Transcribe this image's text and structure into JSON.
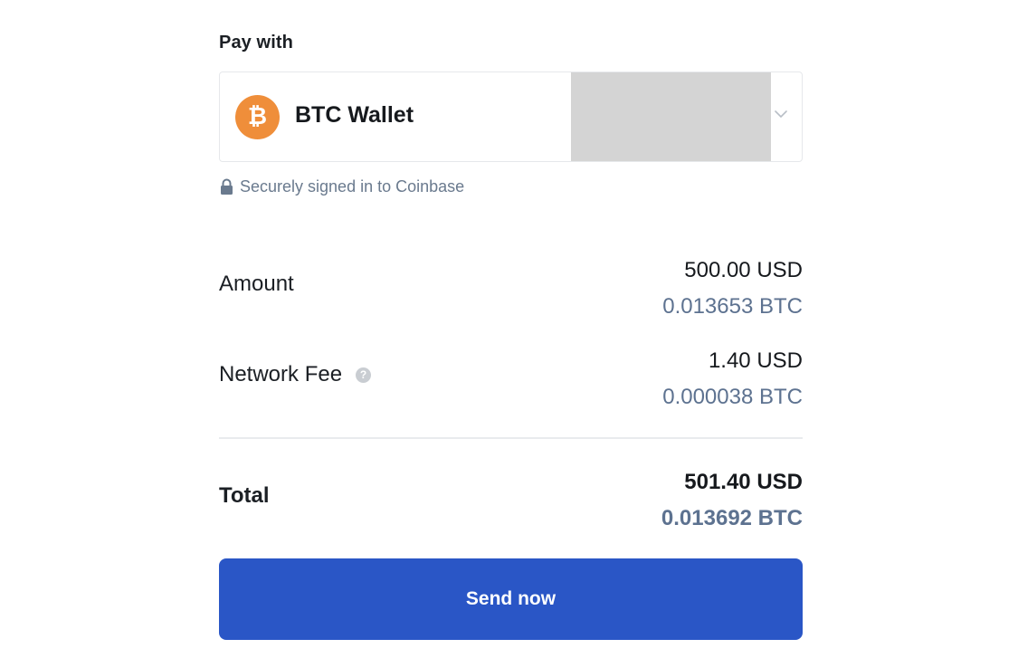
{
  "pay_with": {
    "label": "Pay with",
    "wallet": {
      "icon": "bitcoin-coin-icon",
      "icon_glyph": "₿",
      "icon_color": "#ef8e3a",
      "name": "BTC Wallet"
    },
    "secure_note": "Securely signed in to Coinbase"
  },
  "summary": {
    "amount": {
      "label": "Amount",
      "usd": "500.00 USD",
      "btc": "0.013653 BTC"
    },
    "network_fee": {
      "label": "Network Fee",
      "help_glyph": "?",
      "usd": "1.40 USD",
      "btc": "0.000038 BTC"
    },
    "total": {
      "label": "Total",
      "usd": "501.40 USD",
      "btc": "0.013692 BTC"
    }
  },
  "actions": {
    "send_label": "Send now"
  },
  "colors": {
    "accent": "#2a56c6",
    "btc_secondary_text": "#5d7290",
    "bitcoin_orange": "#ef8e3a"
  }
}
